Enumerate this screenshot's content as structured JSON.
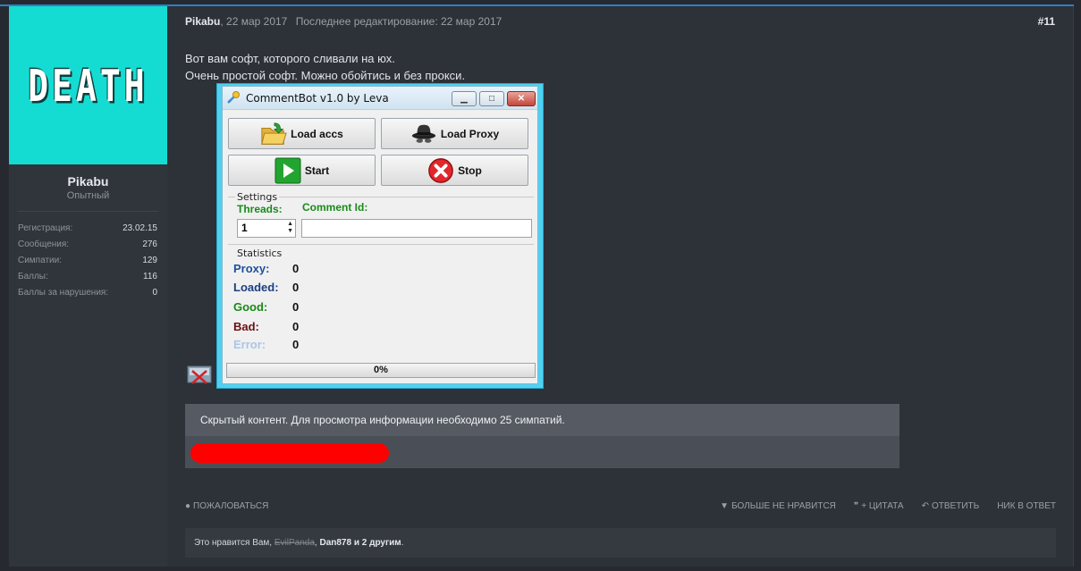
{
  "user": {
    "avatar_text": "DEATH",
    "name": "Pikabu",
    "title": "Опытный",
    "stats": [
      {
        "label": "Регистрация:",
        "value": "23.02.15"
      },
      {
        "label": "Сообщения:",
        "value": "276"
      },
      {
        "label": "Симпатии:",
        "value": "129"
      },
      {
        "label": "Баллы:",
        "value": "116"
      },
      {
        "label": "Баллы за нарушения:",
        "value": "0"
      }
    ]
  },
  "post": {
    "author": "Pikabu",
    "date": ", 22 мар 2017",
    "edited": "Последнее редактирование: 22 мар 2017",
    "number": "#11",
    "line1": "Вот вам софт, которого сливали на юх.",
    "line2": "Очень простой софт. Можно обойтись и без прокси."
  },
  "app": {
    "title": "CommentBot v1.0 by Leva",
    "btn_load_accs": "Load accs",
    "btn_load_proxy": "Load Proxy",
    "btn_start": "Start",
    "btn_stop": "Stop",
    "settings_label": "Settings",
    "threads_label": "Threads:",
    "threads_value": "1",
    "comment_id_label": "Comment Id:",
    "statistics_label": "Statistics",
    "stats": [
      {
        "label": "Proxy:",
        "value": "0",
        "color": "#1f4e9c"
      },
      {
        "label": "Loaded:",
        "value": "0",
        "color": "#1b3f80"
      },
      {
        "label": "Good:",
        "value": "0",
        "color": "#178a17"
      },
      {
        "label": "Bad:",
        "value": "0",
        "color": "#6b0f0f"
      },
      {
        "label": "Error:",
        "value": "0",
        "color": "#a9c6e6"
      }
    ],
    "progress": "0%"
  },
  "hidden": {
    "text": "Скрытый контент. Для просмотра информации необходимо 25 симпатий."
  },
  "actions": {
    "report": "ПОЖАЛОВАТЬСЯ",
    "dislike": "БОЛЬШЕ НЕ НРАВИТСЯ",
    "quote": "+ ЦИТАТА",
    "reply": "ОТВЕТИТЬ",
    "nick": "НИК В ОТВЕТ"
  },
  "likes": {
    "prefix": "Это нравится Вам, ",
    "user1": "EvilPanda",
    "sep": ", ",
    "user2": "Dan878",
    "suffix_and": " и ",
    "others": "2 другим",
    "end": "."
  }
}
